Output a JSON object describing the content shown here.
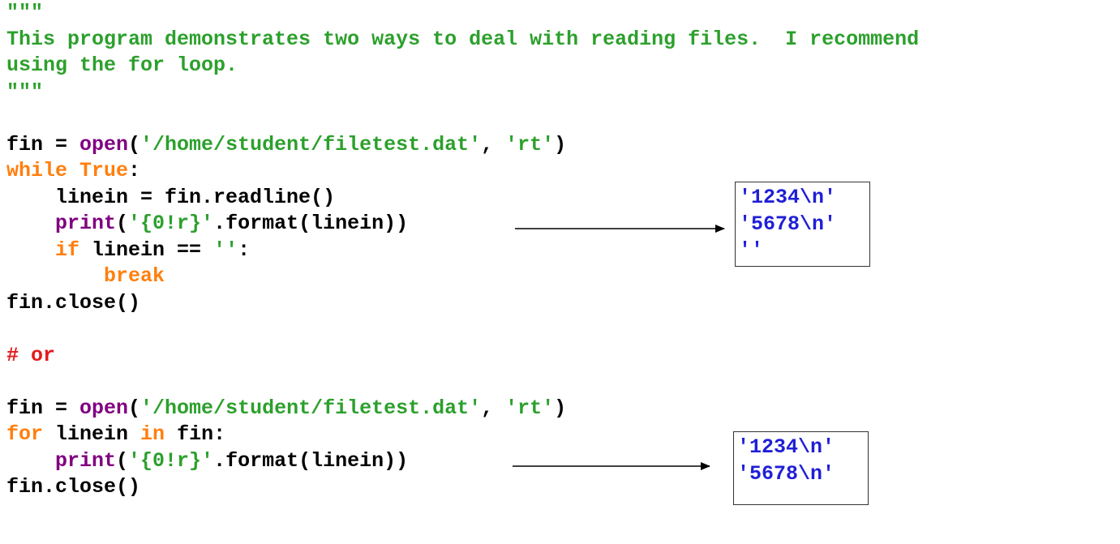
{
  "docstring": {
    "open": "\"\"\"",
    "line1": "This program demonstrates two ways to deal with reading files.  I recommend",
    "line2": "using the for loop.",
    "close": "\"\"\""
  },
  "block1": {
    "l1": {
      "a": "fin = ",
      "b": "open",
      "c": "(",
      "d": "'/home/student/filetest.dat'",
      "e": ", ",
      "f": "'rt'",
      "g": ")"
    },
    "l2": {
      "a": "while",
      "b": " ",
      "c": "True",
      "d": ":"
    },
    "l3": {
      "a": "    linein = fin.readline()"
    },
    "l4": {
      "a": "    ",
      "b": "print",
      "c": "(",
      "d": "'{0!r}'",
      "e": ".format(linein))"
    },
    "l5": {
      "a": "    ",
      "b": "if",
      "c": " linein == ",
      "d": "''",
      "e": ":"
    },
    "l6": {
      "a": "        ",
      "b": "break"
    },
    "l7": {
      "a": "fin.close()"
    }
  },
  "comment": "# or",
  "block2": {
    "l1": {
      "a": "fin = ",
      "b": "open",
      "c": "(",
      "d": "'/home/student/filetest.dat'",
      "e": ", ",
      "f": "'rt'",
      "g": ")"
    },
    "l2": {
      "a": "for",
      "b": " linein ",
      "c": "in",
      "d": " fin:"
    },
    "l3": {
      "a": "    ",
      "b": "print",
      "c": "(",
      "d": "'{0!r}'",
      "e": ".format(linein))"
    },
    "l4": {
      "a": "fin.close()"
    }
  },
  "output1": [
    "'1234\\n'",
    "'5678\\n'",
    "''"
  ],
  "output2": [
    "'1234\\n'",
    "'5678\\n'"
  ],
  "colors": {
    "docstring": "#2ca02c",
    "keyword": "#ff7f0e",
    "builtin": "#800080",
    "string": "#2ca02c",
    "comment": "#e31a1c",
    "output": "#1f1fd6"
  }
}
